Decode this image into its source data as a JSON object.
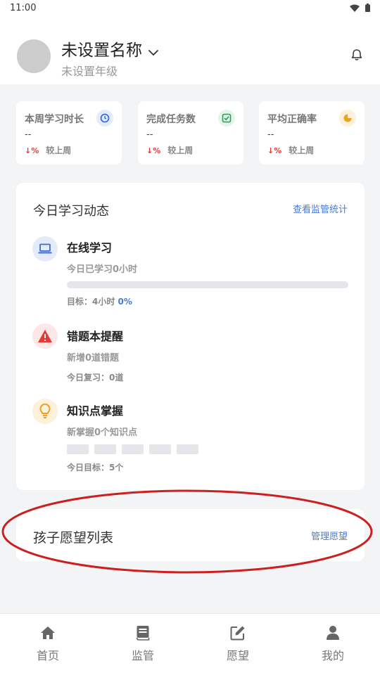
{
  "status_bar": {
    "time": "11:00"
  },
  "profile": {
    "name": "未设置名称",
    "grade": "未设置年级"
  },
  "stats": [
    {
      "title": "本周学习时长",
      "value": "--",
      "trend_arrow": "↓%",
      "compare": "较上周",
      "icon": "clock-icon",
      "icon_color": "#3b6fd8",
      "icon_bg": "#e4ecfb"
    },
    {
      "title": "完成任务数",
      "value": "--",
      "trend_arrow": "↓%",
      "compare": "较上周",
      "icon": "check-square-icon",
      "icon_color": "#2e9d5b",
      "icon_bg": "#e3f4ea"
    },
    {
      "title": "平均正确率",
      "value": "--",
      "trend_arrow": "↓%",
      "compare": "较上周",
      "icon": "pie-chart-icon",
      "icon_color": "#f0a020",
      "icon_bg": "#fdf1dc"
    }
  ],
  "activity": {
    "title": "今日学习动态",
    "link": "查看监管统计",
    "online": {
      "title": "在线学习",
      "subtitle": "今日已学习0小时",
      "goal_prefix": "目标：4小时",
      "percent_label": "0%",
      "progress_fraction": 0,
      "icon": "laptop-icon"
    },
    "mistakes": {
      "title": "错题本提醒",
      "subtitle": "新增0道错题",
      "meta": "今日复习：0道",
      "icon": "warning-icon"
    },
    "knowledge": {
      "title": "知识点掌握",
      "subtitle": "新掌握0个知识点",
      "meta": "今日目标：5个",
      "segments_filled": 0,
      "segments_total": 5,
      "icon": "lightbulb-icon"
    }
  },
  "wishes": {
    "title": "孩子愿望列表",
    "link": "管理愿望"
  },
  "nav": [
    {
      "label": "首页",
      "icon": "home-icon"
    },
    {
      "label": "监管",
      "icon": "book-icon"
    },
    {
      "label": "愿望",
      "icon": "edit-icon"
    },
    {
      "label": "我的",
      "icon": "user-icon"
    }
  ],
  "colors": {
    "accent": "#4a7ad6",
    "trend_down": "#e53935",
    "annotation": "#cc1f1f"
  }
}
